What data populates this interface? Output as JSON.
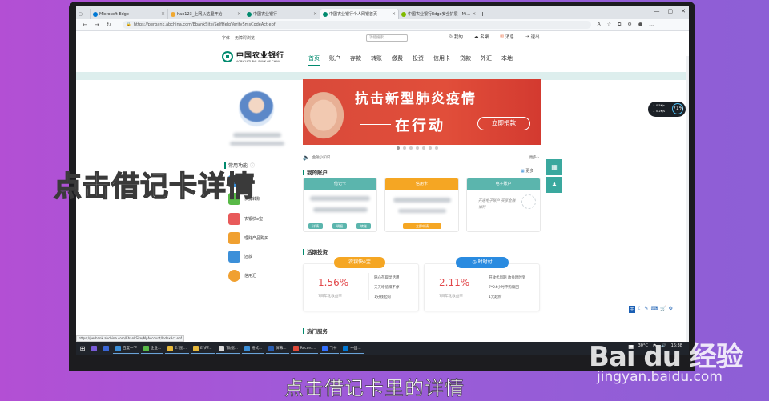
{
  "browser": {
    "tabs": [
      {
        "label": "Microsoft Edge",
        "color": "#0078d4",
        "active": false
      },
      {
        "label": "hao123_上网从这里开始",
        "color": "#f0a830",
        "active": false
      },
      {
        "label": "中国农业银行",
        "color": "#008a6e",
        "active": false
      },
      {
        "label": "中国农业银行个人网银首页",
        "color": "#008a6e",
        "active": true
      },
      {
        "label": "中国农业银行Edge安全扩展 - Mi…",
        "color": "#7fba00",
        "active": false
      }
    ],
    "new_tab": "+",
    "url": "https://perbank.abchina.com/EbankSite/SelfHelpVerifySmsCodeAct.ebf"
  },
  "topline": {
    "font_label": "字体",
    "accessible_label": "无障碍浏览",
    "search_placeholder": "功能搜索",
    "links": [
      "我的",
      "名聚",
      "消息",
      "退出"
    ]
  },
  "header": {
    "logo_cn": "中国农业银行",
    "logo_en": "AGRICULTURAL BANK OF CHINA",
    "nav": [
      "首页",
      "账户",
      "存款",
      "转账",
      "缴费",
      "投资",
      "信用卡",
      "贷款",
      "外汇",
      "本地"
    ]
  },
  "banner": {
    "title": "抗击新型肺炎疫情",
    "subtitle": "在行动",
    "button": "立即捐款"
  },
  "notice": {
    "text": "金融小知识",
    "more": "更多"
  },
  "functions": {
    "title": "常用功能",
    "items": [
      {
        "label": "账户",
        "color": "#3b8fd9"
      },
      {
        "label": "快捷转账",
        "color": "#58b947"
      },
      {
        "label": "农银快e宝",
        "color": "#e85a5a"
      },
      {
        "label": "理财产品购买",
        "color": "#f0a030"
      },
      {
        "label": "还款",
        "color": "#3b8fd9"
      },
      {
        "label": "信用汇",
        "color": "#f0a030"
      }
    ]
  },
  "accounts": {
    "title": "我的账户",
    "more": "更多",
    "cards": [
      {
        "title": "借记卡",
        "color": "#5bb5ad",
        "buttons": [
          "详情",
          "明细",
          "转账"
        ]
      },
      {
        "title": "信用卡",
        "color": "#f5a623",
        "buttons": [
          "立即申请"
        ]
      },
      {
        "title": "电子账户",
        "color": "#5bb5ad",
        "note": "开通电子账户 买享金融福利"
      }
    ]
  },
  "invest": {
    "title": "活期投资",
    "products": [
      {
        "name": "农银快e宝",
        "color": "#f5a623",
        "rate": "1.56%",
        "rate_label": "7日年化收益率",
        "features": [
          "随心存取灵活用",
          "天天增值赚不停",
          "1分钱起购"
        ]
      },
      {
        "name": "时时付",
        "color": "#2a8be0",
        "rate": "2.11%",
        "rate_label": "7日年化收益率",
        "features": [
          "开放式周期 收益时时到",
          "7*24小时申购赎回",
          "1元起购"
        ]
      }
    ]
  },
  "hot": {
    "title": "热门服务"
  },
  "gauge": {
    "up": "0.5K/s",
    "down": "0.2K/s",
    "value": "71%"
  },
  "statusbar": {
    "url": "https://perbank.abchina.com/EbankSite/MyAccount/IndexAct.ebf"
  },
  "taskbar": {
    "items": [
      "百度一下",
      "企业...",
      "E:\\图...",
      "E:\\FF...",
      "\"数据...",
      "格式...",
      "屏幕...",
      "Record...",
      "飞书",
      "中国..."
    ],
    "temp": "30°C",
    "time": "16:38"
  },
  "captions": {
    "overlay": "点击借记卡详情",
    "subtitle": "点击借记卡里的详情",
    "watermark": "Bai du 经验",
    "watermark_url": "jingyan.baidu.com"
  }
}
